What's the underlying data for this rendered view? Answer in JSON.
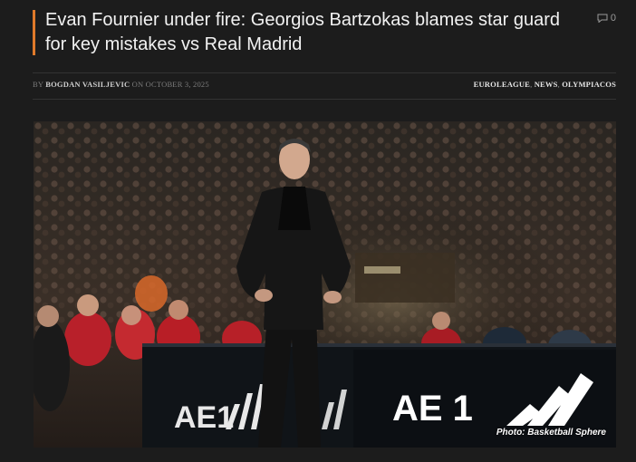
{
  "article": {
    "title": "Evan Fournier under fire: Georgios Bartzokas blames star guard for key mistakes vs Real Madrid",
    "comment_count": "0",
    "byline_prefix": "BY",
    "author": "BOGDAN VASILJEVIC",
    "date_prefix": "ON",
    "date": "OCTOBER 3, 2025",
    "categories": [
      "EUROLEAGUE",
      "NEWS",
      "OLYMPIACOS"
    ],
    "photo": {
      "caption": "Photo: Basketball Sphere",
      "board_text": [
        "AE1",
        "AE 1"
      ]
    }
  },
  "colors": {
    "background": "#1c1c1c",
    "accent": "#e07a2a",
    "title": "#f2f2f2"
  },
  "icons": {
    "comments": "speech-bubble-icon"
  }
}
